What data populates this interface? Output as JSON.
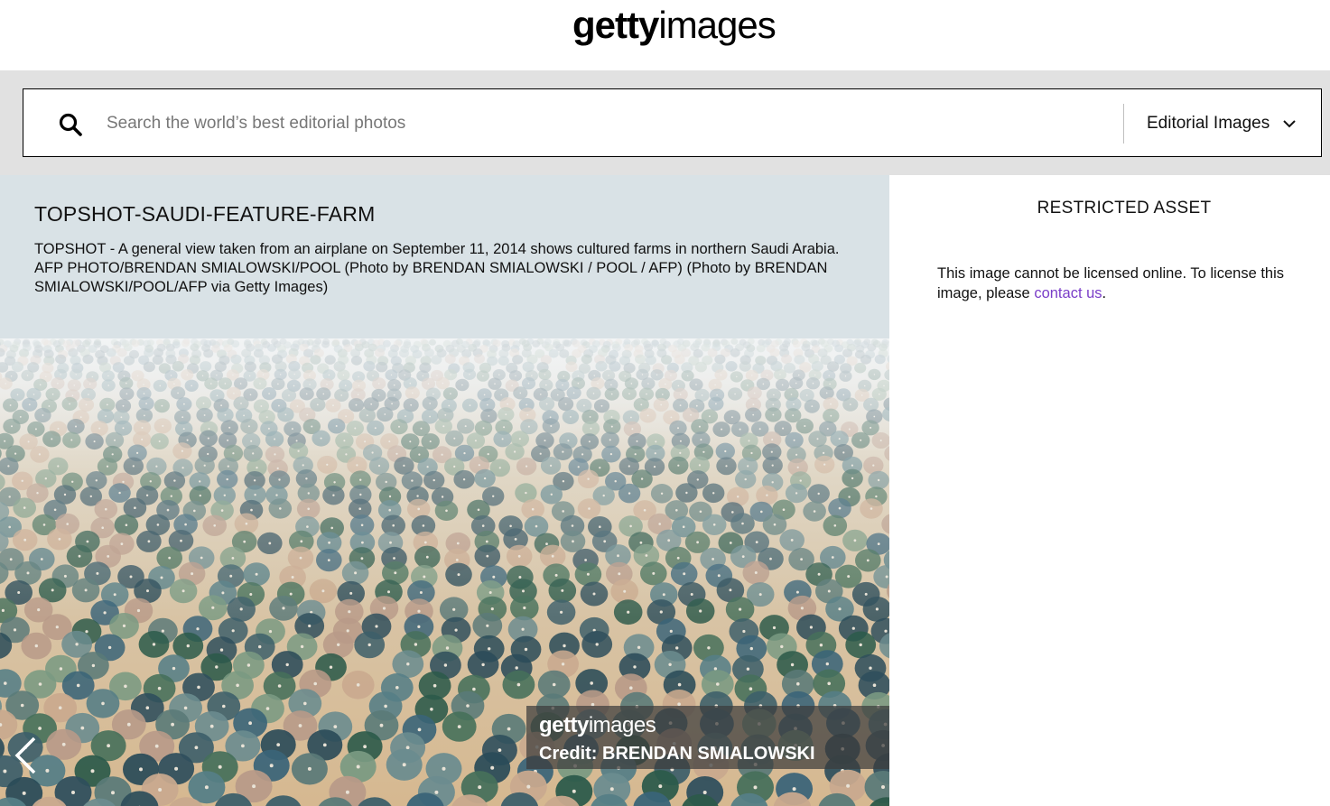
{
  "header": {
    "logo_bold": "getty",
    "logo_light": "images"
  },
  "search": {
    "placeholder": "Search the world’s best editorial photos",
    "value": "",
    "type_selected": "Editorial Images"
  },
  "caption": {
    "title": "TOPSHOT-SAUDI-FEATURE-FARM",
    "description": "TOPSHOT - A general view taken from an airplane on September 11, 2014 shows cultured farms in northern Saudi Arabia. AFP PHOTO/BRENDAN SMIALOWSKI/POOL (Photo by BRENDAN SMIALOWSKI / POOL / AFP) (Photo by BRENDAN SMIALOWSKI/POOL/AFP via Getty Images)"
  },
  "photo": {
    "watermark_bold": "getty",
    "watermark_light": "images",
    "credit": "Credit: BRENDAN SMIALOWSKI"
  },
  "panel": {
    "title": "RESTRICTED ASSET",
    "message_prefix": "This image cannot be licensed online. To license this image, please ",
    "link_text": "contact us",
    "message_suffix": ".",
    "link_color": "#7a3ec8"
  },
  "icons": {
    "search": "search-icon",
    "chevron": "chevron-down-icon",
    "prev": "chevron-left-icon"
  },
  "colors": {
    "search_band": "#e1e1e1",
    "caption_bg": "#d9e2e6"
  }
}
